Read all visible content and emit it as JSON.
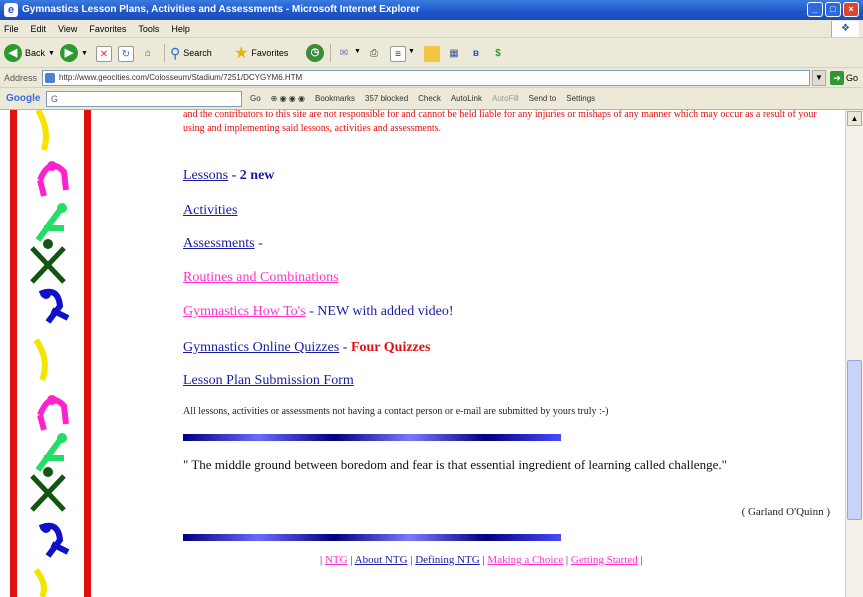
{
  "window": {
    "title": "Gymnastics Lesson Plans, Activities and Assessments - Microsoft Internet Explorer",
    "controls": [
      "_",
      "□",
      "×"
    ]
  },
  "menu": [
    "File",
    "Edit",
    "View",
    "Favorites",
    "Tools",
    "Help"
  ],
  "toolbar": {
    "back": "Back",
    "search": "Search",
    "favorites": "Favorites"
  },
  "address": {
    "label": "Address",
    "url": "http://www.geocities.com/Colosseum/Stadium/7251/DCYGYM6.HTM",
    "go": "Go"
  },
  "google_bar": {
    "logo": "Google",
    "search_prefix": "G",
    "go": "Go",
    "bookmarks": "Bookmarks",
    "blocked": "357 blocked",
    "check": "Check",
    "autolink": "AutoLink",
    "autofill": "AutoFill",
    "sendto": "Send to",
    "settings": "Settings"
  },
  "page": {
    "disclaimer": "and the contributors to this site are not responsible for and cannot be held liable for any injuries or mishaps of any manner which may occur as a result of your using and implementing said lessons, activities and assessments.",
    "links": {
      "lessons": "Lessons",
      "lessons_suffix": " - 2 new",
      "activities": "Activities",
      "assessments": "Assessments",
      "assessments_suffix": " -",
      "routines": "Routines and Combinations",
      "howtos": "Gymnastics How To's",
      "howtos_suffix": " - NEW with added video!",
      "quizzes": "Gymnastics Online Quizzes",
      "quizzes_dash": " - ",
      "quizzes_suffix": "Four Quizzes",
      "submission": "Lesson Plan Submission Form"
    },
    "note": "All lessons, activities or assessments not having a contact person or e-mail are submitted by yours truly :-)",
    "quote": "\" The middle ground between boredom and fear is that essential ingredient of learning called challenge.\"",
    "credit": "( Garland O'Quinn )",
    "footer": {
      "ntg": "NTG",
      "about": "About NTG",
      "defining": "Defining NTG",
      "choice": "Making a Choice",
      "started": "Getting Started"
    }
  },
  "colors": {
    "link_blue": "#1a1aa6",
    "link_pink": "#ff33cc",
    "disclaimer_red": "#e01010"
  }
}
